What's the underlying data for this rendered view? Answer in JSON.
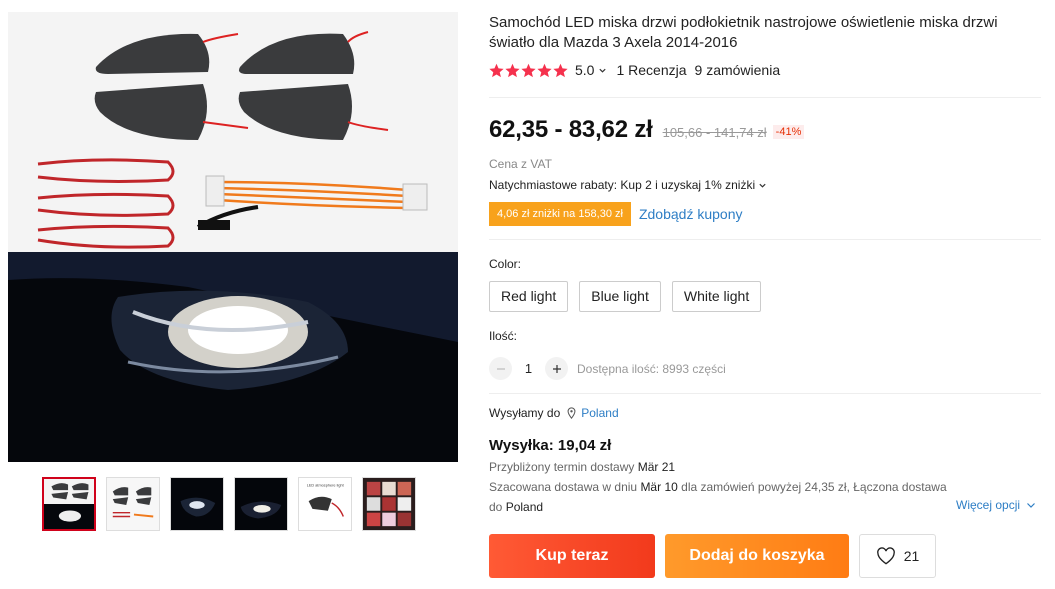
{
  "product": {
    "title": "Samochód LED miska drzwi podłokietnik nastrojowe oświetlenie miska drzwi światło dla Mazda 3 Axela 2014-2016"
  },
  "rating": {
    "stars": 5,
    "value": "5.0",
    "reviews": "1 Recenzja",
    "orders": "9 zamówienia"
  },
  "price": {
    "current": "62,35 - 83,62 zł",
    "original": "105,66 - 141,74 zł",
    "discount": "-41%",
    "vat_note": "Cena z VAT"
  },
  "rebate": {
    "text": "Natychmiastowe rabaty: Kup 2 i uzyskaj 1% zniżki"
  },
  "coupon": {
    "badge": "4,06 zł zniżki na 158,30 zł",
    "link": "Zdobądź kupony"
  },
  "variants": {
    "label": "Color:",
    "options": [
      "Red light",
      "Blue light",
      "White light"
    ]
  },
  "quantity": {
    "label": "Ilość:",
    "value": "1",
    "stock": "Dostępna ilość: 8993 części"
  },
  "shipping": {
    "ship_to_label": "Wysyłamy do",
    "country": "Poland",
    "cost": "Wysyłka: 19,04 zł",
    "estimate_prefix": "Przybliżony termin dostawy",
    "estimate_date": "Mär 21",
    "line2_prefix": "Szacowana dostawa w dniu",
    "line2_date": "Mär 10",
    "line2_suffix": "dla zamówień powyżej 24,35 zł, Łączona dostawa",
    "line3_prefix": "do",
    "line3_country": "Poland",
    "more_options": "Więcej opcji"
  },
  "actions": {
    "buy_now": "Kup teraz",
    "add_to_cart": "Dodaj do koszyka",
    "wishlist_count": "21"
  },
  "colors": {
    "star": "#f5314d",
    "link": "#2e7ec5",
    "coupon": "#f8a21c",
    "buy": "#f23a1c",
    "cart": "#ff7c14"
  },
  "thumbnails": {
    "count": 6,
    "active_index": 0,
    "thumb5_caption": "LED atmosphere light"
  }
}
